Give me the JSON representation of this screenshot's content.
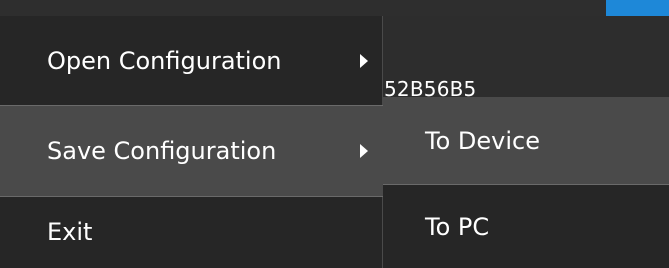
{
  "background": {
    "device_id_partial": "52B56B5"
  },
  "main_menu": {
    "items": [
      {
        "label": "Open Configuration",
        "has_submenu": true
      },
      {
        "label": "Save Configuration",
        "has_submenu": true,
        "highlighted": true
      },
      {
        "label": "Exit",
        "has_submenu": false
      }
    ]
  },
  "submenu": {
    "items": [
      {
        "label": "To Device",
        "highlighted": true
      },
      {
        "label": "To PC"
      }
    ]
  },
  "colors": {
    "menu_bg": "#262626",
    "highlight_bg": "#4a4a4a",
    "accent": "#1e88d8",
    "text": "#ffffff"
  }
}
